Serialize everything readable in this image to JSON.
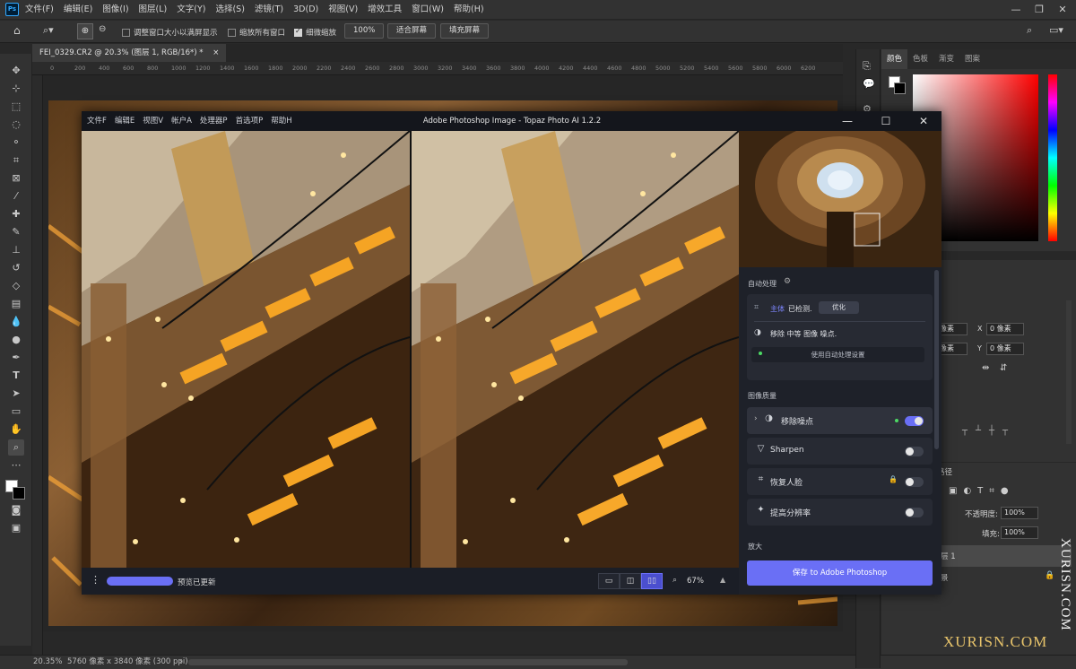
{
  "ps": {
    "logo": "Ps",
    "menus": [
      "文件(F)",
      "编辑(E)",
      "图像(I)",
      "图层(L)",
      "文字(Y)",
      "选择(S)",
      "滤镜(T)",
      "3D(D)",
      "视图(V)",
      "增效工具",
      "窗口(W)",
      "帮助(H)"
    ],
    "window_controls": [
      "—",
      "❐",
      "✕"
    ],
    "options": {
      "resize_windows": "调整窗口大小以满屏显示",
      "zoom_all": "缩放所有窗口",
      "scrubby_zoom": "细微缩放",
      "zoom_value": "100%",
      "fit_screen": "适合屏幕",
      "fill_screen": "填充屏幕"
    },
    "doc_tab": "FEI_0329.CR2 @ 20.3% (图层 1, RGB/16*) *",
    "doc_tab_close": "×",
    "ruler_ticks": [
      "0",
      "200",
      "400",
      "600",
      "800",
      "1000",
      "1200",
      "1400",
      "1600",
      "1800",
      "2000",
      "2200",
      "2400",
      "2600",
      "2800",
      "3000",
      "3200",
      "3400",
      "3600",
      "3800",
      "4000",
      "4200",
      "4400",
      "4600",
      "4800",
      "5000",
      "5200",
      "5400",
      "5600",
      "5800",
      "6000",
      "6200"
    ],
    "status": {
      "zoom": "20.35%",
      "size": "5760 像素 x 3840 像素 (300 ppi)",
      "arrow": "›"
    },
    "color_panel": {
      "tabs": [
        "颜色",
        "色板",
        "渐变",
        "图案"
      ]
    },
    "properties": {
      "w": "像素",
      "h": "像素",
      "x_label": "X",
      "y_label": "Y",
      "x": "0 像素",
      "y": "0 像素"
    },
    "layers": {
      "tab": "路径",
      "opacity_label": "不透明度:",
      "opacity": "100%",
      "fill_label": "填充:",
      "fill": "100%",
      "layer1": "层 1",
      "layer2": "景"
    }
  },
  "topaz": {
    "menus": [
      "文件F",
      "编辑E",
      "视图V",
      "帐户A",
      "处理器P",
      "首选项P",
      "帮助H"
    ],
    "title": "Adobe Photoshop Image - Topaz Photo AI 1.2.2",
    "controls": [
      "—",
      "☐",
      "✕"
    ],
    "status": "预览已更新",
    "zoom": "67%",
    "auto_title": "自动处理",
    "subject_label": "主体",
    "subject_text": "已检测.",
    "optimize_btn": "优化",
    "remove_text": "移除 中等 图像 噪点.",
    "auto_settings_btn": "使用自动处理设置",
    "quality_title": "图像质量",
    "items": [
      {
        "label": "移除噪点",
        "on": true
      },
      {
        "label": "Sharpen",
        "on": false
      },
      {
        "label": "恢复人脸",
        "on": false
      },
      {
        "label": "提高分辨率",
        "on": false
      }
    ],
    "enlarge_title": "放大",
    "save_btn": "保存 to Adobe Photoshop"
  },
  "watermark": {
    "vertical": "XURISN.COM",
    "horizontal": "XURISN.COM"
  },
  "colors": {
    "accent": "#6a6ff5",
    "ps_bg": "#323232",
    "topaz_bg": "#1e2129"
  }
}
